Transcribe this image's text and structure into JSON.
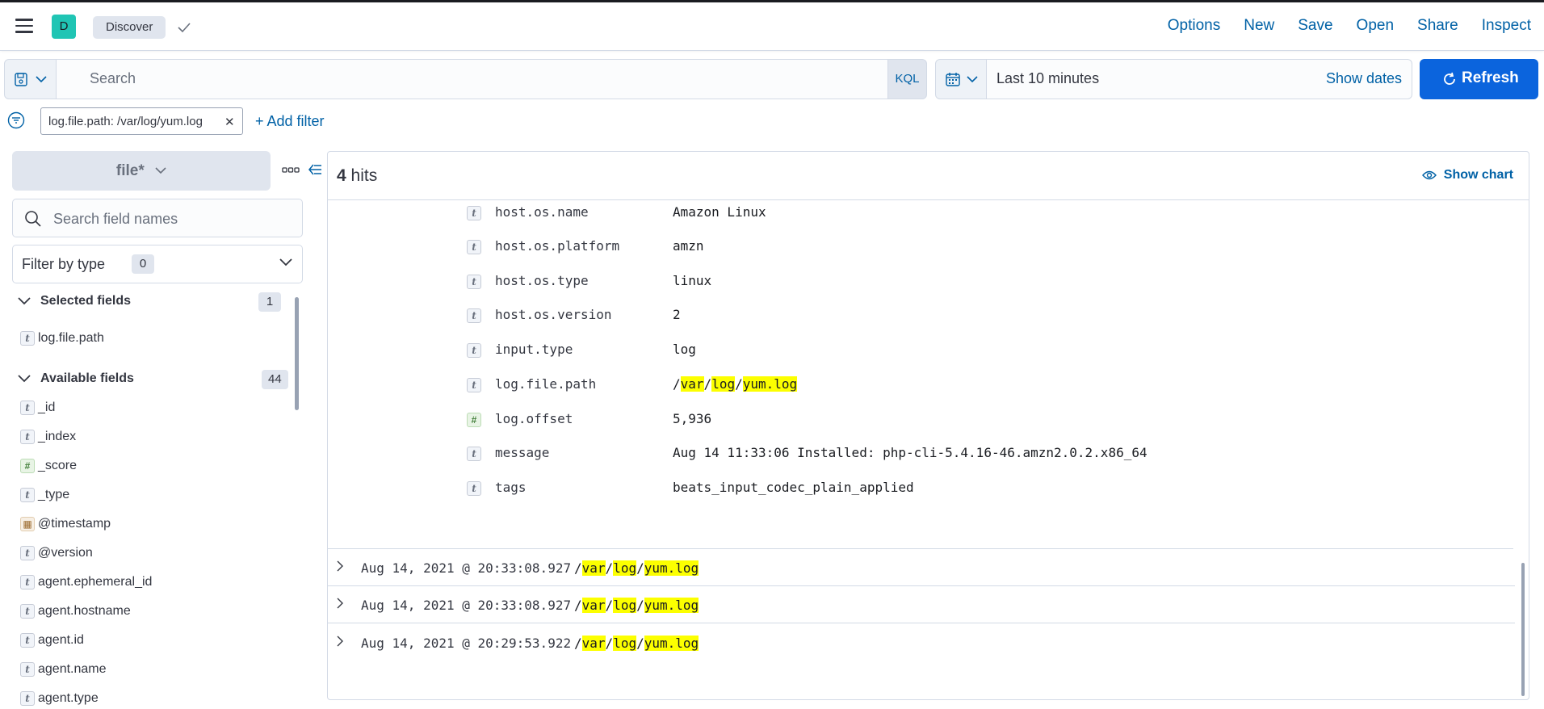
{
  "header": {
    "space_initial": "D",
    "breadcrumb": "Discover",
    "nav": [
      "Options",
      "New",
      "Save",
      "Open",
      "Share",
      "Inspect"
    ]
  },
  "query": {
    "search_placeholder": "Search",
    "language": "KQL",
    "date_value": "Last 10 minutes",
    "show_dates_label": "Show dates",
    "refresh_label": "Refresh"
  },
  "filters": {
    "pill": "log.file.path: /var/log/yum.log",
    "add_label": "+ Add filter"
  },
  "sidebar": {
    "index_pattern": "file*",
    "search_placeholder": "Search field names",
    "filter_by_type": {
      "label": "Filter by type",
      "count": "0"
    },
    "selected": {
      "label": "Selected fields",
      "count": "1",
      "fields": [
        {
          "name": "log.file.path",
          "type": "t"
        }
      ]
    },
    "available": {
      "label": "Available fields",
      "count": "44",
      "fields": [
        {
          "name": "_id",
          "type": "t"
        },
        {
          "name": "_index",
          "type": "t"
        },
        {
          "name": "_score",
          "type": "#"
        },
        {
          "name": "_type",
          "type": "t"
        },
        {
          "name": "@timestamp",
          "type": "date"
        },
        {
          "name": "@version",
          "type": "t"
        },
        {
          "name": "agent.ephemeral_id",
          "type": "t"
        },
        {
          "name": "agent.hostname",
          "type": "t"
        },
        {
          "name": "agent.id",
          "type": "t"
        },
        {
          "name": "agent.name",
          "type": "t"
        },
        {
          "name": "agent.type",
          "type": "t"
        }
      ]
    }
  },
  "main": {
    "hits_count": "4",
    "hits_label": " hits",
    "show_chart_label": "Show chart",
    "doc_detail": [
      {
        "name": "host.os.name",
        "type": "t",
        "value": "Amazon Linux"
      },
      {
        "name": "host.os.platform",
        "type": "t",
        "value": "amzn"
      },
      {
        "name": "host.os.type",
        "type": "t",
        "value": "linux"
      },
      {
        "name": "host.os.version",
        "type": "t",
        "value": "2"
      },
      {
        "name": "input.type",
        "type": "t",
        "value": "log"
      },
      {
        "name": "log.file.path",
        "type": "t",
        "value": "/var/log/yum.log"
      },
      {
        "name": "log.offset",
        "type": "#",
        "value": "5,936"
      },
      {
        "name": "message",
        "type": "t",
        "value": "Aug 14 11:33:06 Installed: php-cli-5.4.16-46.amzn2.0.2.x86_64"
      },
      {
        "name": "tags",
        "type": "t",
        "value": "beats_input_codec_plain_applied"
      }
    ],
    "rows": [
      {
        "timestamp": "Aug 14, 2021 @ 20:33:08.927",
        "path": "/var/log/yum.log"
      },
      {
        "timestamp": "Aug 14, 2021 @ 20:33:08.927",
        "path": "/var/log/yum.log"
      },
      {
        "timestamp": "Aug 14, 2021 @ 20:29:53.922",
        "path": "/var/log/yum.log"
      }
    ],
    "path_parts": {
      "slash": "/",
      "p1": "var",
      "p2": "log",
      "p3": "yum.log"
    }
  }
}
